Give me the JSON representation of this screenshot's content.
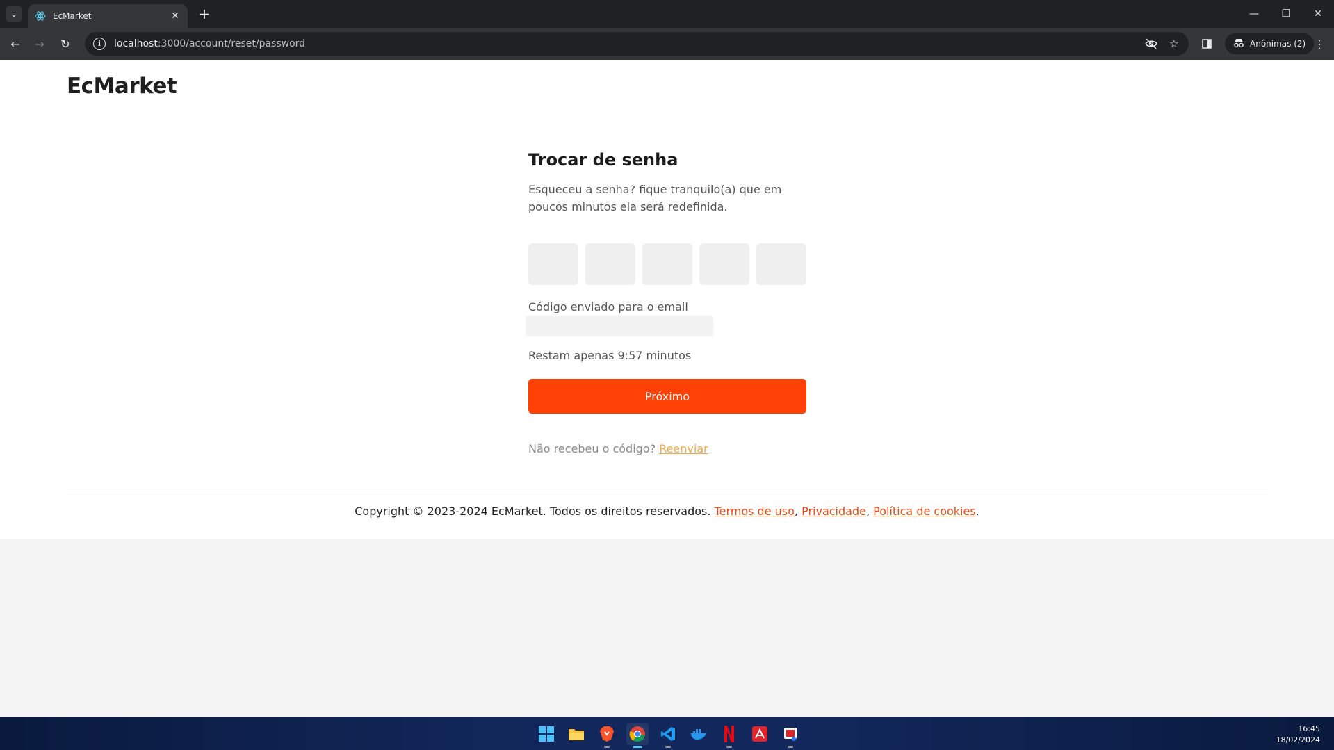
{
  "browser": {
    "tab_title": "EcMarket",
    "url_host": "localhost",
    "url_rest": ":3000/account/reset/password",
    "incognito_label": "Anônimas (2)"
  },
  "site": {
    "logo": "EcMarket"
  },
  "reset": {
    "title": "Trocar de senha",
    "description": "Esqueceu a senha? fique tranquilo(a) que em poucos minutos ela será redefinida.",
    "code_digits": [
      "",
      "",
      "",
      "",
      ""
    ],
    "sent_label": "Código enviado para o email",
    "timer_text": "Restam apenas 9:57 minutos",
    "next_button": "Próximo",
    "resend_prompt": "Não recebeu o código?",
    "resend_link": "Reenviar"
  },
  "footer": {
    "copyright": "Copyright © 2023-2024 EcMarket. Todos os direitos reservados.",
    "terms": "Termos de uso",
    "privacy": "Privacidade",
    "cookies": "Política de cookies",
    "sep1": ",",
    "sep2": ",",
    "end": "."
  },
  "taskbar": {
    "time": "16:45",
    "date": "18/02/2024",
    "apps": [
      "windows-start",
      "file-explorer",
      "brave",
      "chrome",
      "vscode",
      "docker",
      "netflix",
      "adobe-acrobat",
      "snipping-tool"
    ]
  },
  "colors": {
    "accent": "#ff4106",
    "link": "#e84a1a",
    "resend_link": "#f4a94c"
  }
}
